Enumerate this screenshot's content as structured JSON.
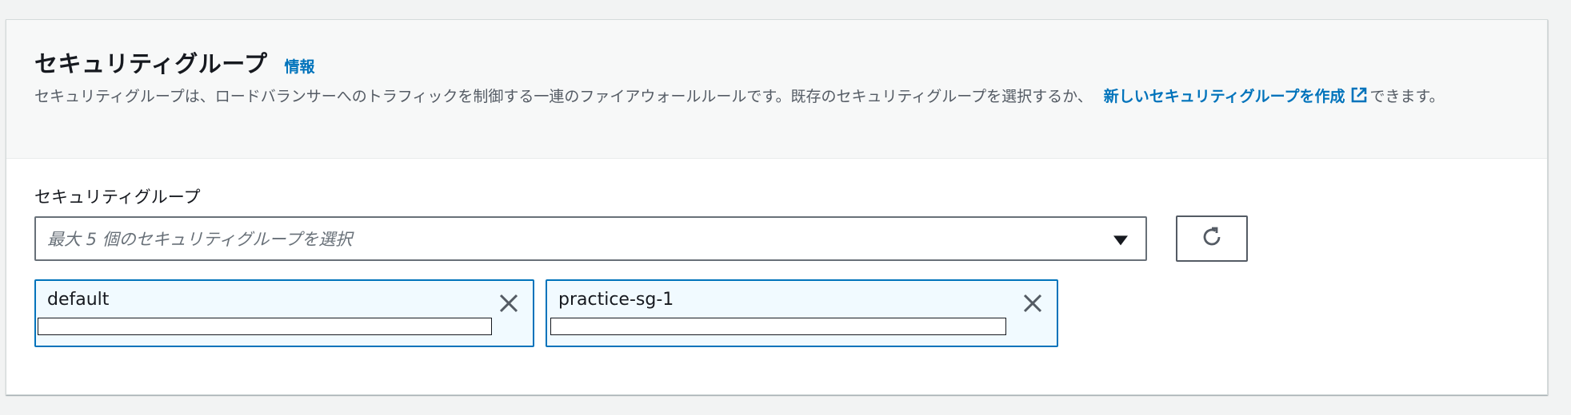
{
  "panel": {
    "title": "セキュリティグループ",
    "info_link": "情報",
    "description_text": "セキュリティグループは、ロードバランサーへのトラフィックを制御する一連のファイアウォールルールです。既存のセキュリティグループを選択するか、",
    "create_link": "新しいセキュリティグループを作成",
    "description_suffix": "できます。"
  },
  "field": {
    "label": "セキュリティグループ",
    "placeholder": "最大 5 個のセキュリティグループを選択"
  },
  "tokens": [
    {
      "label": "default"
    },
    {
      "label": "practice-sg-1"
    }
  ],
  "icons": {
    "external": "external-link-icon",
    "caret": "caret-down-icon",
    "refresh": "refresh-icon",
    "close": "close-icon"
  },
  "colors": {
    "link": "#0073bb",
    "token_border": "#0073bb",
    "token_bg": "#f1faff"
  }
}
